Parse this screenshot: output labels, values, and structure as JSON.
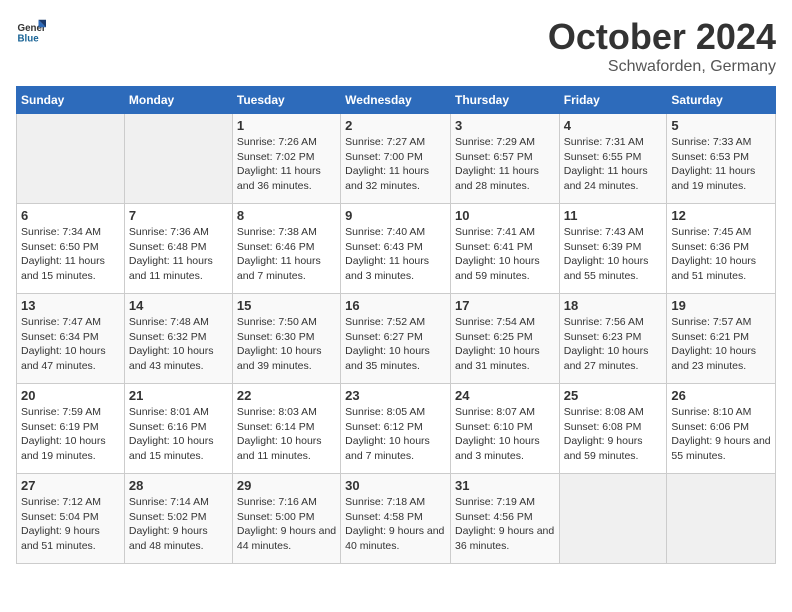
{
  "header": {
    "logo_general": "General",
    "logo_blue": "Blue",
    "title": "October 2024",
    "subtitle": "Schwaforden, Germany"
  },
  "columns": [
    "Sunday",
    "Monday",
    "Tuesday",
    "Wednesday",
    "Thursday",
    "Friday",
    "Saturday"
  ],
  "weeks": [
    [
      {
        "day": "",
        "sunrise": "",
        "sunset": "",
        "daylight": ""
      },
      {
        "day": "",
        "sunrise": "",
        "sunset": "",
        "daylight": ""
      },
      {
        "day": "1",
        "sunrise": "Sunrise: 7:26 AM",
        "sunset": "Sunset: 7:02 PM",
        "daylight": "Daylight: 11 hours and 36 minutes."
      },
      {
        "day": "2",
        "sunrise": "Sunrise: 7:27 AM",
        "sunset": "Sunset: 7:00 PM",
        "daylight": "Daylight: 11 hours and 32 minutes."
      },
      {
        "day": "3",
        "sunrise": "Sunrise: 7:29 AM",
        "sunset": "Sunset: 6:57 PM",
        "daylight": "Daylight: 11 hours and 28 minutes."
      },
      {
        "day": "4",
        "sunrise": "Sunrise: 7:31 AM",
        "sunset": "Sunset: 6:55 PM",
        "daylight": "Daylight: 11 hours and 24 minutes."
      },
      {
        "day": "5",
        "sunrise": "Sunrise: 7:33 AM",
        "sunset": "Sunset: 6:53 PM",
        "daylight": "Daylight: 11 hours and 19 minutes."
      }
    ],
    [
      {
        "day": "6",
        "sunrise": "Sunrise: 7:34 AM",
        "sunset": "Sunset: 6:50 PM",
        "daylight": "Daylight: 11 hours and 15 minutes."
      },
      {
        "day": "7",
        "sunrise": "Sunrise: 7:36 AM",
        "sunset": "Sunset: 6:48 PM",
        "daylight": "Daylight: 11 hours and 11 minutes."
      },
      {
        "day": "8",
        "sunrise": "Sunrise: 7:38 AM",
        "sunset": "Sunset: 6:46 PM",
        "daylight": "Daylight: 11 hours and 7 minutes."
      },
      {
        "day": "9",
        "sunrise": "Sunrise: 7:40 AM",
        "sunset": "Sunset: 6:43 PM",
        "daylight": "Daylight: 11 hours and 3 minutes."
      },
      {
        "day": "10",
        "sunrise": "Sunrise: 7:41 AM",
        "sunset": "Sunset: 6:41 PM",
        "daylight": "Daylight: 10 hours and 59 minutes."
      },
      {
        "day": "11",
        "sunrise": "Sunrise: 7:43 AM",
        "sunset": "Sunset: 6:39 PM",
        "daylight": "Daylight: 10 hours and 55 minutes."
      },
      {
        "day": "12",
        "sunrise": "Sunrise: 7:45 AM",
        "sunset": "Sunset: 6:36 PM",
        "daylight": "Daylight: 10 hours and 51 minutes."
      }
    ],
    [
      {
        "day": "13",
        "sunrise": "Sunrise: 7:47 AM",
        "sunset": "Sunset: 6:34 PM",
        "daylight": "Daylight: 10 hours and 47 minutes."
      },
      {
        "day": "14",
        "sunrise": "Sunrise: 7:48 AM",
        "sunset": "Sunset: 6:32 PM",
        "daylight": "Daylight: 10 hours and 43 minutes."
      },
      {
        "day": "15",
        "sunrise": "Sunrise: 7:50 AM",
        "sunset": "Sunset: 6:30 PM",
        "daylight": "Daylight: 10 hours and 39 minutes."
      },
      {
        "day": "16",
        "sunrise": "Sunrise: 7:52 AM",
        "sunset": "Sunset: 6:27 PM",
        "daylight": "Daylight: 10 hours and 35 minutes."
      },
      {
        "day": "17",
        "sunrise": "Sunrise: 7:54 AM",
        "sunset": "Sunset: 6:25 PM",
        "daylight": "Daylight: 10 hours and 31 minutes."
      },
      {
        "day": "18",
        "sunrise": "Sunrise: 7:56 AM",
        "sunset": "Sunset: 6:23 PM",
        "daylight": "Daylight: 10 hours and 27 minutes."
      },
      {
        "day": "19",
        "sunrise": "Sunrise: 7:57 AM",
        "sunset": "Sunset: 6:21 PM",
        "daylight": "Daylight: 10 hours and 23 minutes."
      }
    ],
    [
      {
        "day": "20",
        "sunrise": "Sunrise: 7:59 AM",
        "sunset": "Sunset: 6:19 PM",
        "daylight": "Daylight: 10 hours and 19 minutes."
      },
      {
        "day": "21",
        "sunrise": "Sunrise: 8:01 AM",
        "sunset": "Sunset: 6:16 PM",
        "daylight": "Daylight: 10 hours and 15 minutes."
      },
      {
        "day": "22",
        "sunrise": "Sunrise: 8:03 AM",
        "sunset": "Sunset: 6:14 PM",
        "daylight": "Daylight: 10 hours and 11 minutes."
      },
      {
        "day": "23",
        "sunrise": "Sunrise: 8:05 AM",
        "sunset": "Sunset: 6:12 PM",
        "daylight": "Daylight: 10 hours and 7 minutes."
      },
      {
        "day": "24",
        "sunrise": "Sunrise: 8:07 AM",
        "sunset": "Sunset: 6:10 PM",
        "daylight": "Daylight: 10 hours and 3 minutes."
      },
      {
        "day": "25",
        "sunrise": "Sunrise: 8:08 AM",
        "sunset": "Sunset: 6:08 PM",
        "daylight": "Daylight: 9 hours and 59 minutes."
      },
      {
        "day": "26",
        "sunrise": "Sunrise: 8:10 AM",
        "sunset": "Sunset: 6:06 PM",
        "daylight": "Daylight: 9 hours and 55 minutes."
      }
    ],
    [
      {
        "day": "27",
        "sunrise": "Sunrise: 7:12 AM",
        "sunset": "Sunset: 5:04 PM",
        "daylight": "Daylight: 9 hours and 51 minutes."
      },
      {
        "day": "28",
        "sunrise": "Sunrise: 7:14 AM",
        "sunset": "Sunset: 5:02 PM",
        "daylight": "Daylight: 9 hours and 48 minutes."
      },
      {
        "day": "29",
        "sunrise": "Sunrise: 7:16 AM",
        "sunset": "Sunset: 5:00 PM",
        "daylight": "Daylight: 9 hours and 44 minutes."
      },
      {
        "day": "30",
        "sunrise": "Sunrise: 7:18 AM",
        "sunset": "Sunset: 4:58 PM",
        "daylight": "Daylight: 9 hours and 40 minutes."
      },
      {
        "day": "31",
        "sunrise": "Sunrise: 7:19 AM",
        "sunset": "Sunset: 4:56 PM",
        "daylight": "Daylight: 9 hours and 36 minutes."
      },
      {
        "day": "",
        "sunrise": "",
        "sunset": "",
        "daylight": ""
      },
      {
        "day": "",
        "sunrise": "",
        "sunset": "",
        "daylight": ""
      }
    ]
  ]
}
